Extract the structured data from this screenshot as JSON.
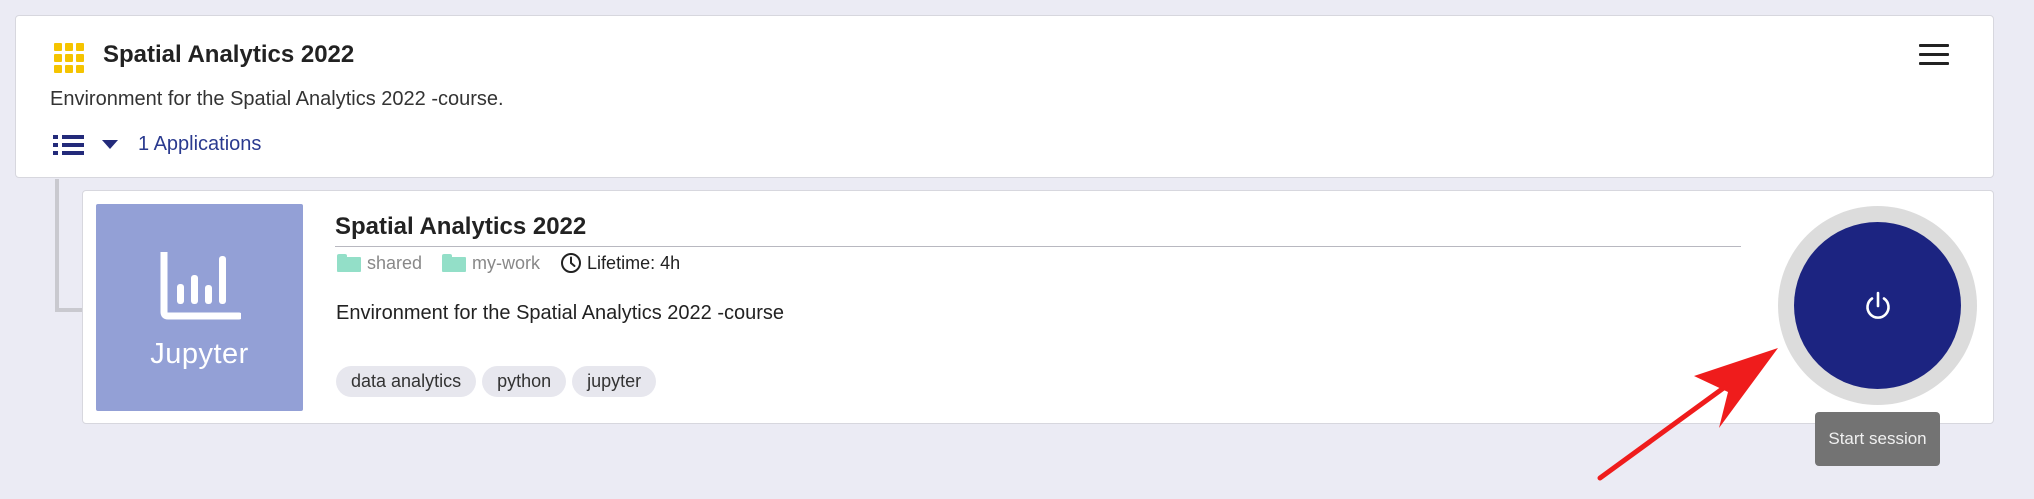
{
  "environment": {
    "title": "Spatial Analytics 2022",
    "description": "Environment for the Spatial Analytics 2022 -course.",
    "applications_label": "1 Applications",
    "icon": "grid-icon"
  },
  "application": {
    "logo_text": "Jupyter",
    "title": "Spatial Analytics 2022",
    "folders": [
      "shared",
      "my-work"
    ],
    "lifetime": "Lifetime: 4h",
    "description": "Environment for the Spatial Analytics 2022 -course",
    "tags": [
      "data analytics",
      "python",
      "jupyter"
    ]
  },
  "session": {
    "tooltip": "Start session",
    "icon": "power-icon"
  },
  "colors": {
    "page_background": "#ebebf4",
    "accent_yellow": "#f5c400",
    "navy": "#1c2481",
    "logo_background": "#93a0d6",
    "folder_green": "#93dfc8",
    "annotation_arrow": "#ef1c1c"
  }
}
